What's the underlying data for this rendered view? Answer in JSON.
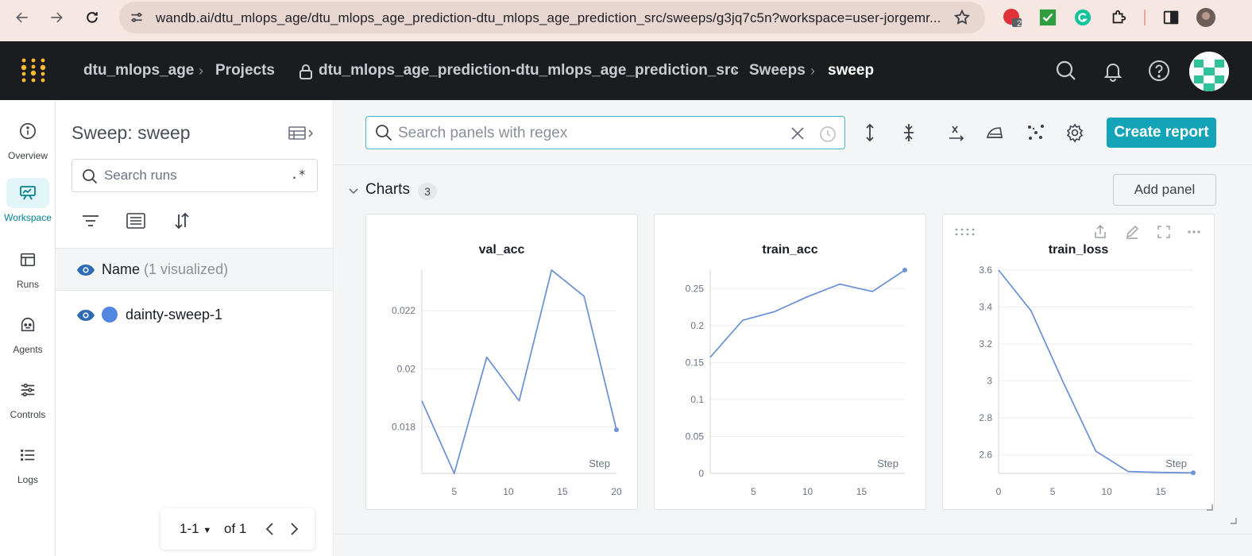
{
  "browser": {
    "url": "wandb.ai/dtu_mlops_age/dtu_mlops_age_prediction-dtu_mlops_age_prediction_src/sweeps/g3jq7c5n?workspace=user-jorgemr...",
    "ext_badge": "2"
  },
  "header": {
    "breadcrumbs": [
      {
        "label": "dtu_mlops_age"
      },
      {
        "label": "Projects"
      },
      {
        "label": "dtu_mlops_age_prediction-dtu_mlops_age_prediction_src"
      },
      {
        "label": "Sweeps"
      },
      {
        "label": "sweep"
      }
    ]
  },
  "rail": {
    "items": [
      {
        "label": "Overview",
        "icon": "info-icon"
      },
      {
        "label": "Workspace",
        "icon": "workspace-icon"
      },
      {
        "label": "Runs",
        "icon": "table-icon"
      },
      {
        "label": "Agents",
        "icon": "robot-icon"
      },
      {
        "label": "Controls",
        "icon": "sliders-icon"
      },
      {
        "label": "Logs",
        "icon": "list-icon"
      }
    ]
  },
  "runs_panel": {
    "title": "Sweep: sweep",
    "search_placeholder": "Search runs",
    "regex_label": ".*",
    "name_header": "Name",
    "name_count": "(1 visualized)",
    "runs": [
      {
        "name": "dainty-sweep-1",
        "color": "#5087e0"
      }
    ],
    "pager": {
      "range": "1-1",
      "of": "of 1"
    }
  },
  "main": {
    "search_placeholder": "Search panels with regex",
    "create_report": "Create report",
    "section_title": "Charts",
    "section_count": "3",
    "add_panel": "Add panel"
  },
  "chart_data": [
    {
      "type": "line",
      "title": "val_acc",
      "xlabel": "Step",
      "x": [
        2,
        5,
        8,
        11,
        14,
        17,
        20
      ],
      "y": [
        0.0189,
        0.0164,
        0.0204,
        0.0189,
        0.0234,
        0.0225,
        0.0179
      ],
      "xlim": [
        2,
        20
      ],
      "ylim": [
        0.0164,
        0.0234
      ],
      "xticks": [
        "5",
        "10",
        "15",
        "20"
      ],
      "yticks": [
        "0.018",
        "0.02",
        "0.022"
      ],
      "color": "#6f94d4"
    },
    {
      "type": "line",
      "title": "train_acc",
      "xlabel": "Step",
      "x": [
        1,
        4,
        7,
        10,
        13,
        16,
        19
      ],
      "y": [
        0.157,
        0.207,
        0.219,
        0.239,
        0.256,
        0.246,
        0.275
      ],
      "xlim": [
        1,
        19
      ],
      "ylim": [
        0,
        0.275
      ],
      "xticks": [
        "5",
        "10",
        "15"
      ],
      "yticks": [
        "0",
        "0.05",
        "0.1",
        "0.15",
        "0.2",
        "0.25"
      ],
      "color": "#6f94d4"
    },
    {
      "type": "line",
      "title": "train_loss",
      "xlabel": "Step",
      "x": [
        0,
        3,
        6,
        9,
        12,
        15,
        18
      ],
      "y": [
        3.6,
        3.38,
        2.99,
        2.62,
        2.51,
        2.505,
        2.503
      ],
      "xlim": [
        0,
        18
      ],
      "ylim": [
        2.5,
        3.6
      ],
      "xticks": [
        "0",
        "5",
        "10",
        "15"
      ],
      "yticks": [
        "2.6",
        "2.8",
        "3",
        "3.2",
        "3.4",
        "3.6"
      ],
      "color": "#6f94d4"
    }
  ]
}
